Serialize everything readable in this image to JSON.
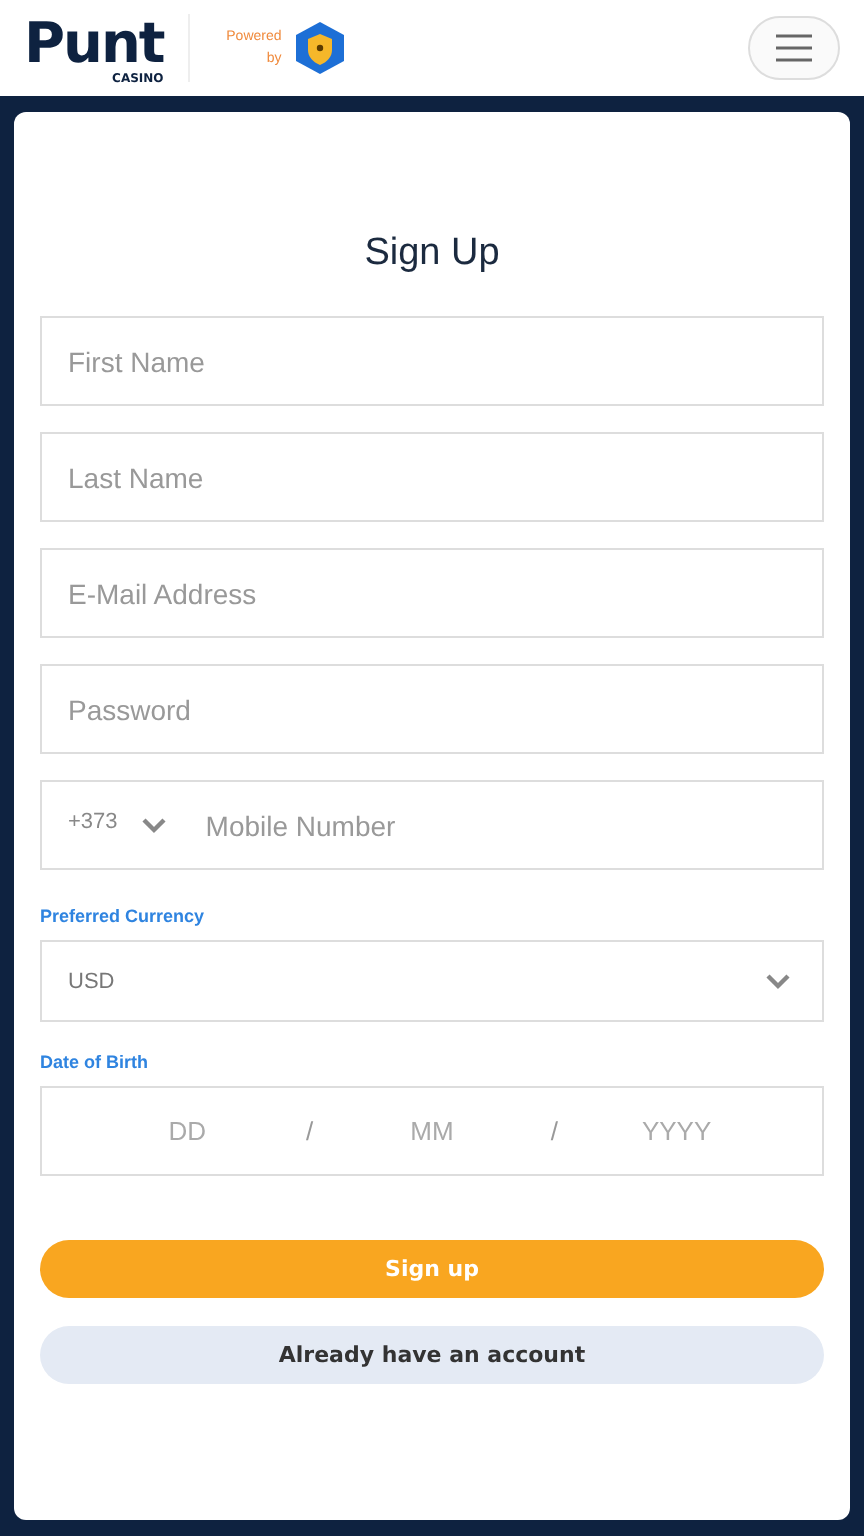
{
  "header": {
    "logo": {
      "name": "Punt",
      "sub": "CASINO"
    },
    "powered_by": "Powered by"
  },
  "form": {
    "title": "Sign Up",
    "fields": [
      {
        "placeholder": "First Name"
      },
      {
        "placeholder": "Last Name"
      },
      {
        "placeholder": "E-Mail Address"
      },
      {
        "placeholder": "Password"
      }
    ],
    "phone": {
      "code": "+373",
      "placeholder": "Mobile Number"
    },
    "currency": {
      "label": "Preferred Currency",
      "value": "USD"
    },
    "date_of_birth": {
      "label": "Date of Birth",
      "parts": [
        {
          "placeholder": "DD"
        },
        {
          "placeholder": "MM"
        },
        {
          "placeholder": "YYYY"
        }
      ],
      "separator": "/"
    },
    "buttons": [
      {
        "kind": "primary",
        "label": "Sign up"
      },
      {
        "kind": "secondary",
        "label": "Already have an account"
      }
    ]
  }
}
